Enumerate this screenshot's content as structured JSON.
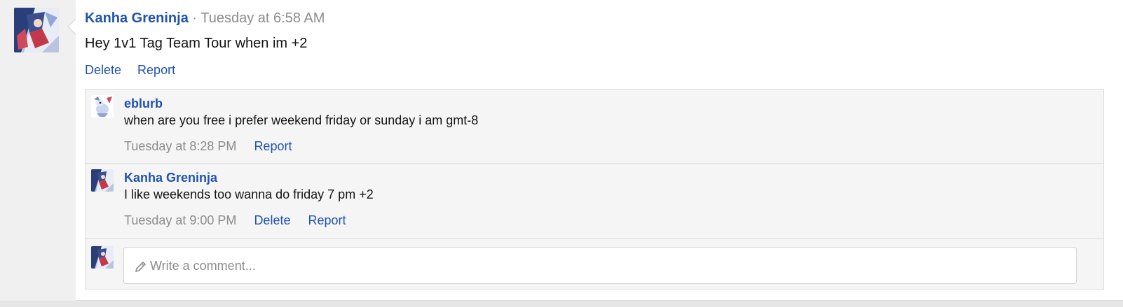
{
  "post": {
    "author": "Kanha Greninja",
    "separator": "·",
    "timestamp": "Tuesday at 6:58 AM",
    "text": "Hey 1v1 Tag Team Tour when im +2",
    "actions": [
      "Delete",
      "Report"
    ]
  },
  "comments": [
    {
      "author": "eblurb",
      "text": "when are you free i prefer weekend friday or sunday i am gmt-8",
      "timestamp": "Tuesday at 8:28 PM",
      "actions": [
        "Report"
      ]
    },
    {
      "author": "Kanha Greninja",
      "text": "I like weekends too wanna do friday 7 pm +2",
      "timestamp": "Tuesday at 9:00 PM",
      "actions": [
        "Delete",
        "Report"
      ]
    }
  ],
  "reply": {
    "placeholder": "Write a comment...",
    "icon": "pencil-icon"
  },
  "colors": {
    "link": "#2153b0",
    "muted": "#8c8c8c",
    "panel": "#f5f5f5"
  }
}
